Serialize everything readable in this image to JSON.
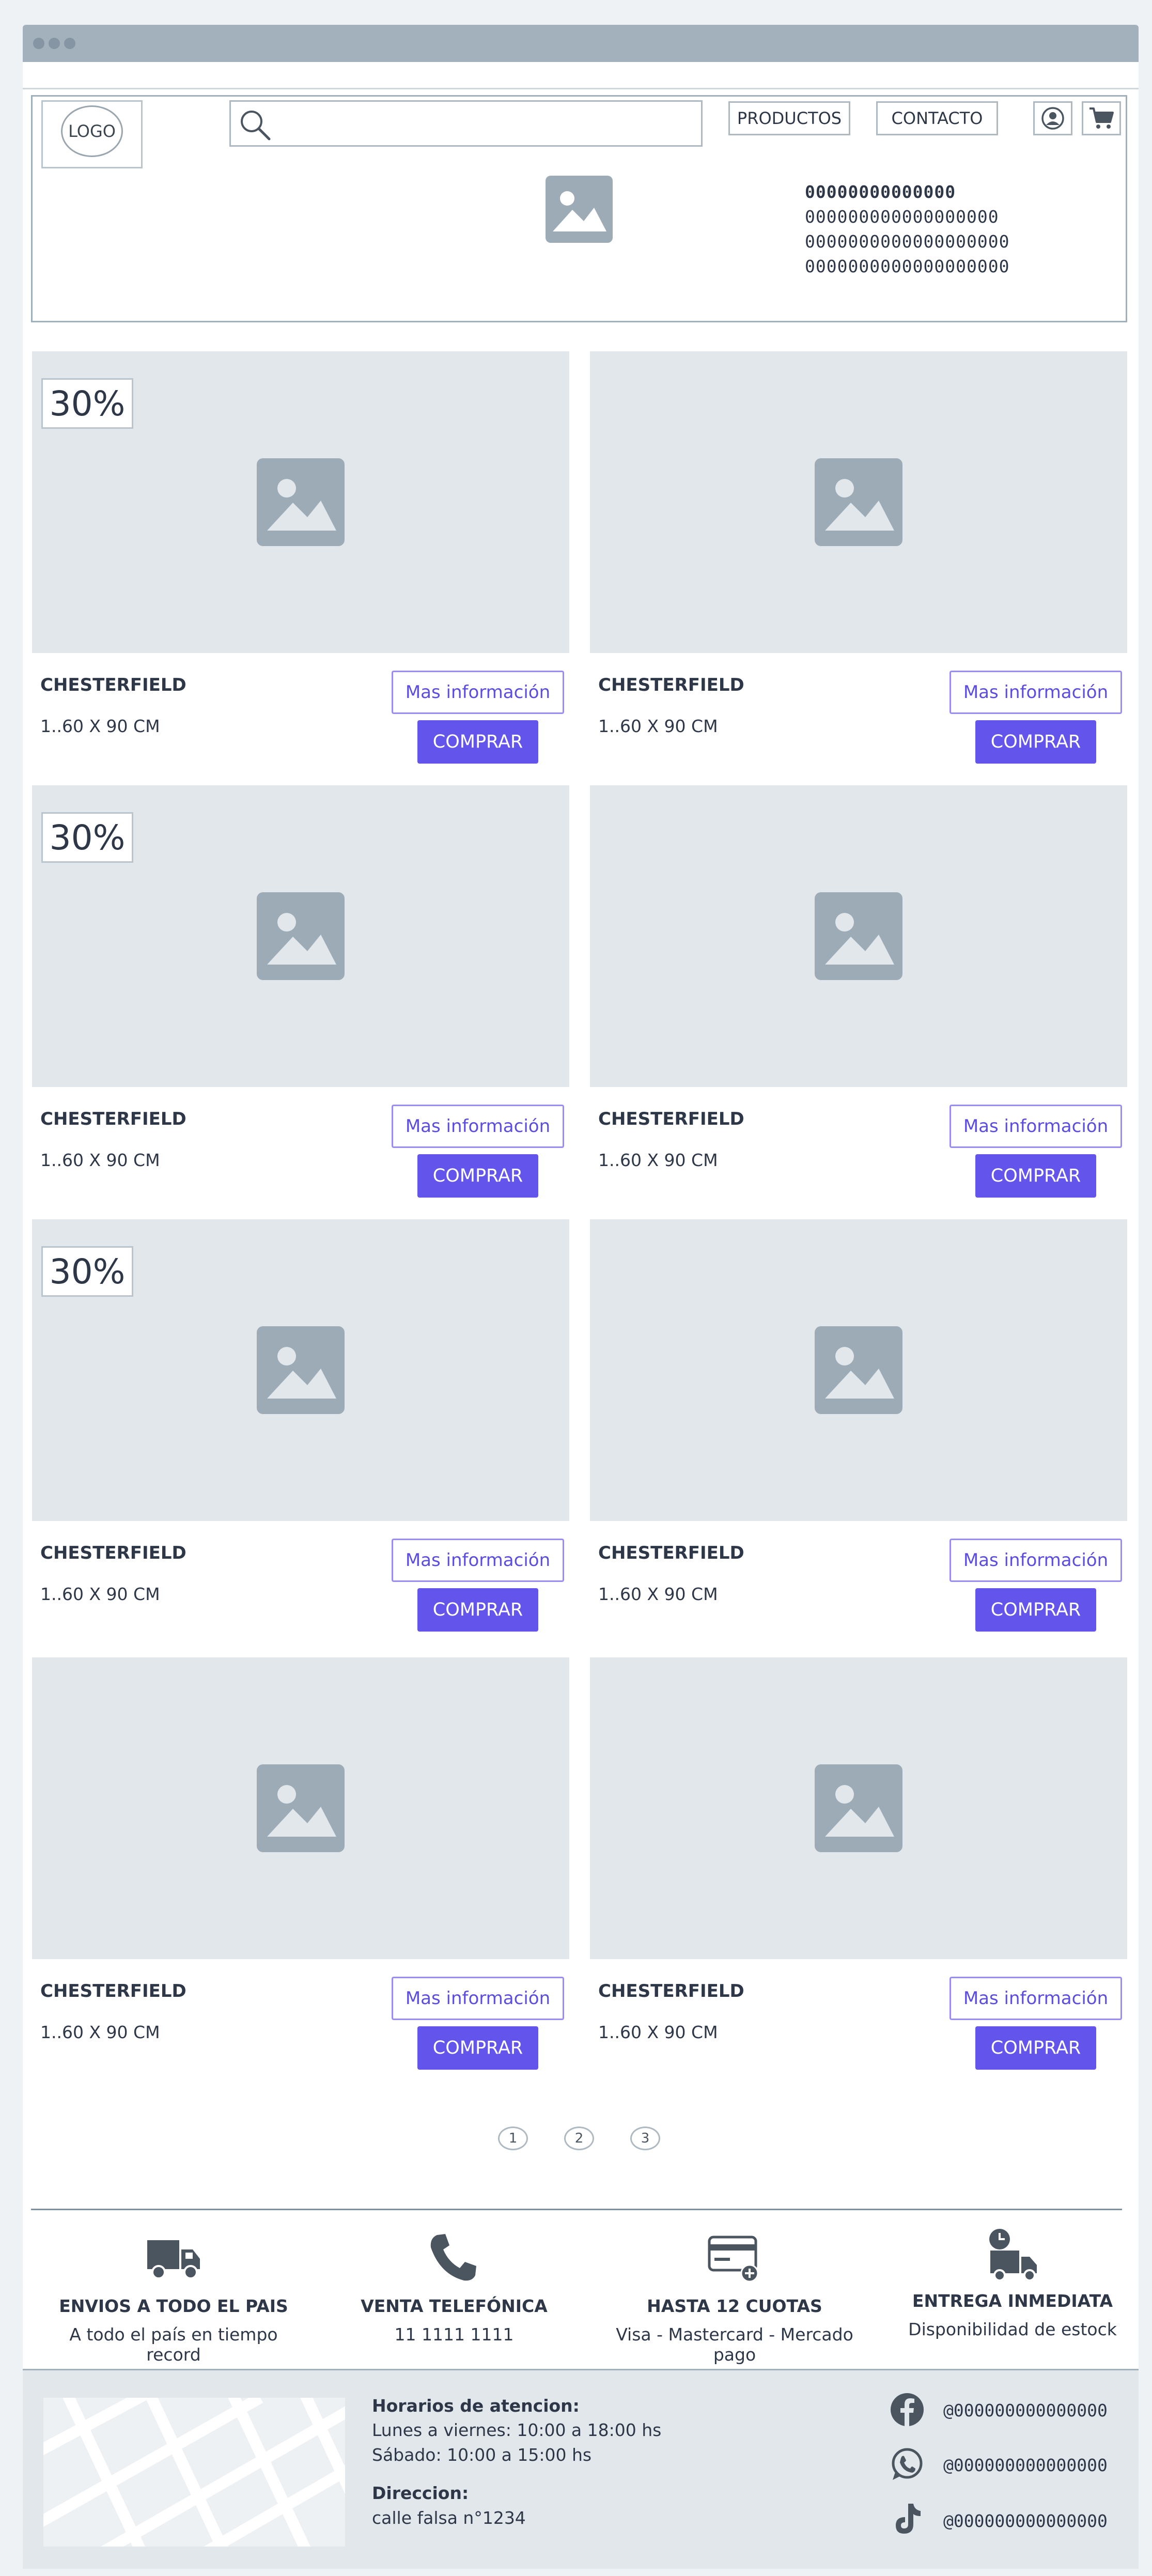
{
  "header": {
    "logo": "LOGO",
    "search": {
      "placeholder": "",
      "value": ""
    },
    "nav": [
      "PRODUCTOS",
      "CONTACTO"
    ],
    "icons": [
      "user-icon",
      "cart-icon"
    ],
    "hero_text": [
      "00000000000000",
      "000000000000000000",
      "0000000000000000000",
      "0000000000000000000"
    ]
  },
  "products": [
    {
      "badge": "30%",
      "title": "CHESTERFIELD",
      "size": "1..60 X 90 CM",
      "info": "Mas información",
      "buy": "COMPRAR"
    },
    {
      "badge": "",
      "title": "CHESTERFIELD",
      "size": "1..60 X 90 CM",
      "info": "Mas información",
      "buy": "COMPRAR"
    },
    {
      "badge": "30%",
      "title": "CHESTERFIELD",
      "size": "1..60 X 90 CM",
      "info": "Mas información",
      "buy": "COMPRAR"
    },
    {
      "badge": "",
      "title": "CHESTERFIELD",
      "size": "1..60 X 90 CM",
      "info": "Mas información",
      "buy": "COMPRAR"
    },
    {
      "badge": "30%",
      "title": "CHESTERFIELD",
      "size": "1..60 X 90 CM",
      "info": "Mas información",
      "buy": "COMPRAR"
    },
    {
      "badge": "",
      "title": "CHESTERFIELD",
      "size": "1..60 X 90 CM",
      "info": "Mas información",
      "buy": "COMPRAR"
    },
    {
      "badge": "",
      "title": "CHESTERFIELD",
      "size": "1..60 X 90 CM",
      "info": "Mas información",
      "buy": "COMPRAR"
    },
    {
      "badge": "",
      "title": "CHESTERFIELD",
      "size": "1..60 X 90 CM",
      "info": "Mas información",
      "buy": "COMPRAR"
    }
  ],
  "pagination": [
    "1",
    "2",
    "3"
  ],
  "features": [
    {
      "icon": "truck-icon",
      "title": "ENVIOS A TODO EL PAIS",
      "subtitle": "A todo el país en tiempo record"
    },
    {
      "icon": "phone-icon",
      "title": "VENTA TELEFÓNICA",
      "subtitle": "11 1111 1111"
    },
    {
      "icon": "credit-card-icon",
      "title": "HASTA 12 CUOTAS",
      "subtitle": "Visa - Mastercard - Mercado pago"
    },
    {
      "icon": "delivery-clock-icon",
      "title": "ENTREGA INMEDIATA",
      "subtitle": "Disponibilidad de estock"
    }
  ],
  "footer": {
    "hours_label": "Horarios de atencion:",
    "hours_weekdays": "Lunes a viernes: 10:00 a 18:00 hs",
    "hours_saturday": "Sábado: 10:00 a 15:00 hs",
    "address_label": "Direccion:",
    "address": "calle falsa n°1234",
    "social": [
      {
        "icon": "facebook-icon",
        "handle": "@000000000000000"
      },
      {
        "icon": "whatsapp-icon",
        "handle": "@000000000000000"
      },
      {
        "icon": "tiktok-icon",
        "handle": "@000000000000000"
      }
    ]
  },
  "colors": {
    "accent": "#6354ec",
    "placeholder_bg": "#e2e7eb",
    "icon_gray": "#9dabb6"
  }
}
